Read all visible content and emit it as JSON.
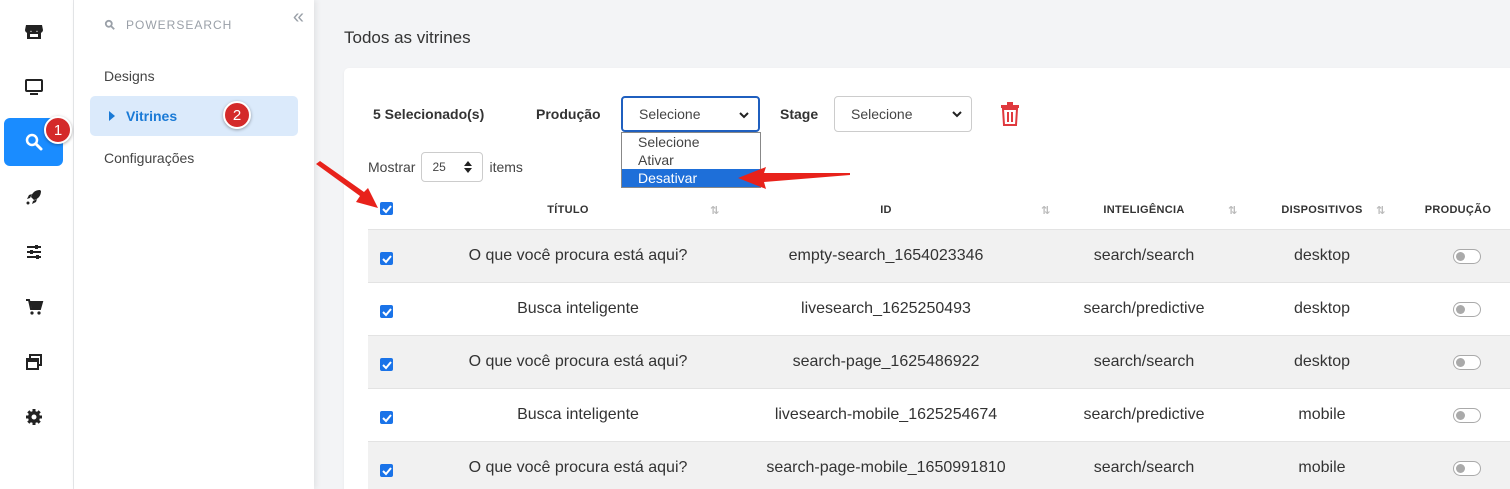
{
  "rail": {
    "items": [
      {
        "icon": "store-icon"
      },
      {
        "icon": "monitor-icon"
      },
      {
        "icon": "search-icon",
        "active": true
      },
      {
        "icon": "rocket-icon"
      },
      {
        "icon": "sliders-icon"
      },
      {
        "icon": "cart-icon"
      },
      {
        "icon": "windows-icon"
      },
      {
        "icon": "gear-icon"
      }
    ],
    "badge": "1"
  },
  "sidebar": {
    "header": "POWERSEARCH",
    "items": [
      "Designs",
      "Vitrines",
      "Configurações"
    ],
    "badge": "2"
  },
  "page": {
    "title": "Todos as vitrines"
  },
  "toolbar": {
    "selected": "5 Selecionado(s)",
    "producao_label": "Produção",
    "producao_value": "Selecione",
    "stage_label": "Stage",
    "stage_value": "Selecione",
    "dropdown_options": [
      "Selecione",
      "Ativar",
      "Desativar"
    ],
    "highlighted_option": "Desativar"
  },
  "pagination": {
    "show_label": "Mostrar",
    "page_size": "25",
    "items_label": "items"
  },
  "table": {
    "columns": [
      "TÍTULO",
      "ID",
      "INTELIGÊNCIA",
      "DISPOSITIVOS",
      "PRODUÇÃO"
    ],
    "rows": [
      {
        "title": "O que você procura está aqui?",
        "id": "empty-search_1654023346",
        "intel": "search/search",
        "device": "desktop"
      },
      {
        "title": "Busca inteligente",
        "id": "livesearch_1625250493",
        "intel": "search/predictive",
        "device": "desktop"
      },
      {
        "title": "O que você procura está aqui?",
        "id": "search-page_1625486922",
        "intel": "search/search",
        "device": "desktop"
      },
      {
        "title": "Busca inteligente",
        "id": "livesearch-mobile_1625254674",
        "intel": "search/predictive",
        "device": "mobile"
      },
      {
        "title": "O que você procura está aqui?",
        "id": "search-page-mobile_1650991810",
        "intel": "search/search",
        "device": "mobile"
      }
    ]
  },
  "colors": {
    "accent": "#1a8cff",
    "badge": "#d42a2a",
    "trash": "#e0393e",
    "arrow": "#e8221b"
  }
}
